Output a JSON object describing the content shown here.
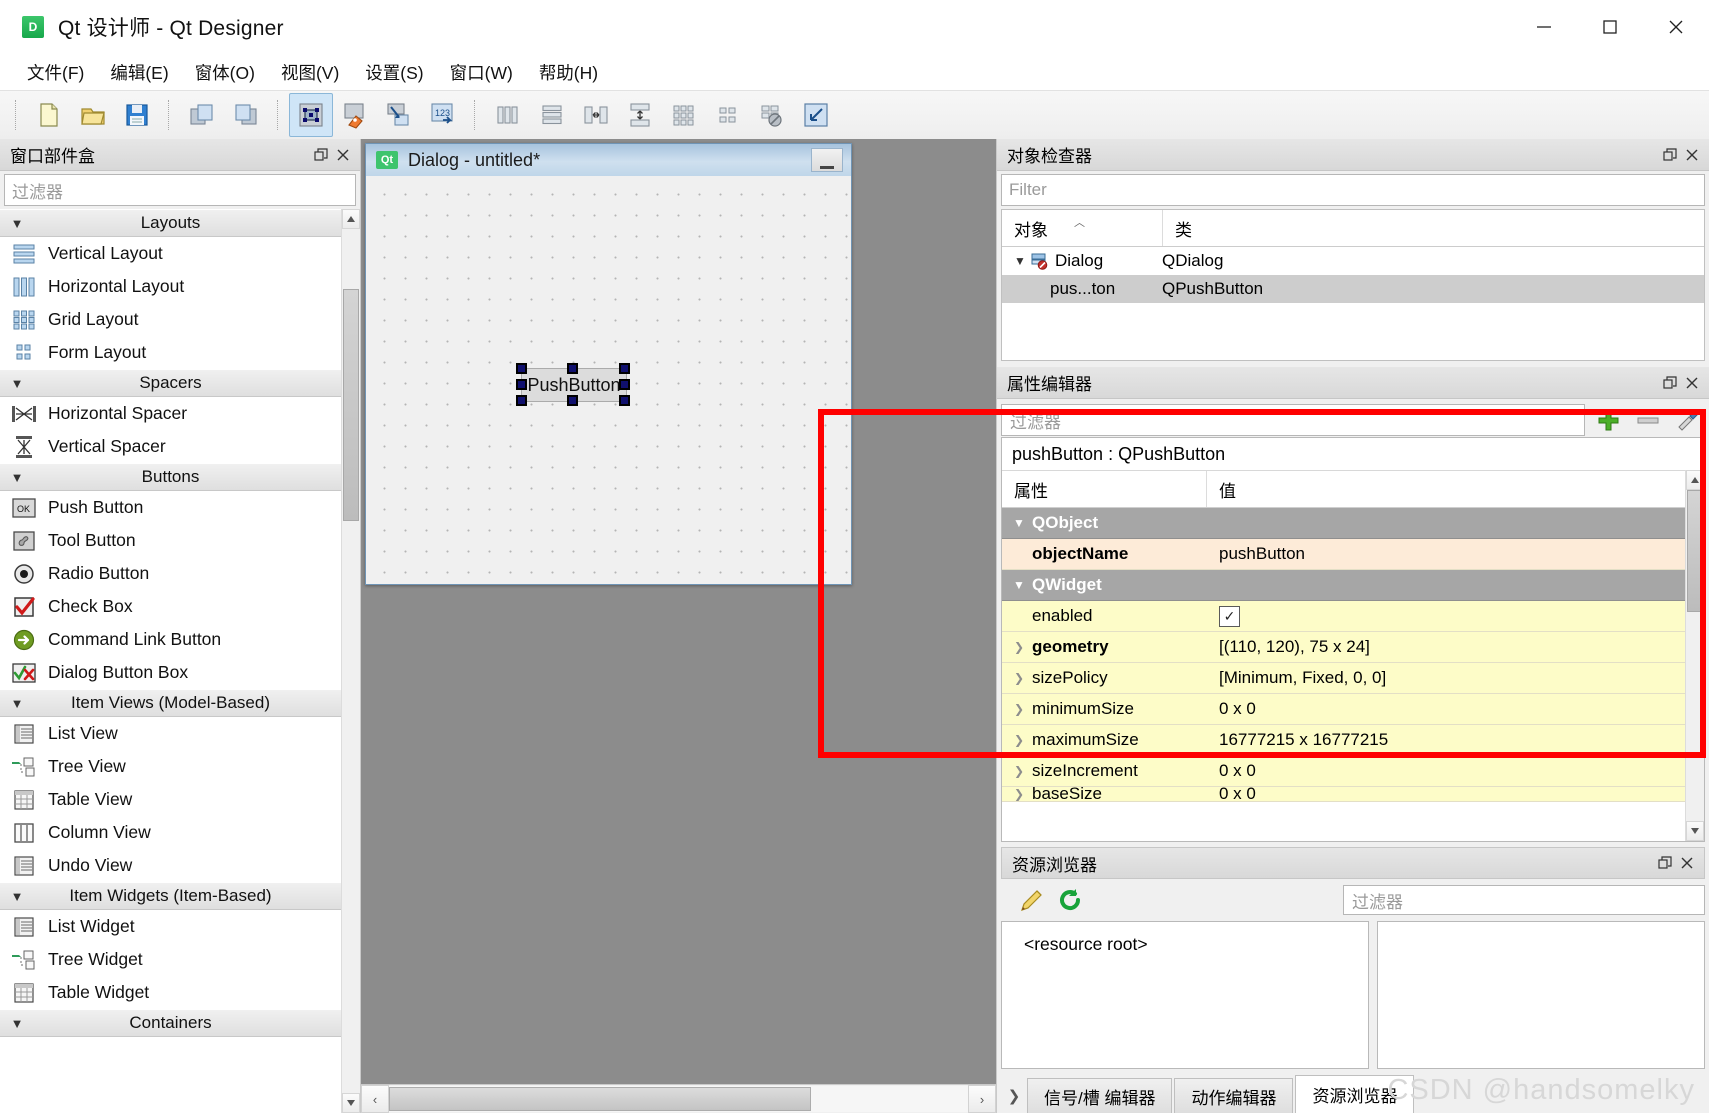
{
  "window": {
    "title": "Qt 设计师 - Qt Designer",
    "icon": "qt-designer-icon",
    "minimize": "−",
    "maximize": "□",
    "close": "✕"
  },
  "menubar": {
    "items": [
      {
        "label": "文件(F)",
        "name": "menu-file"
      },
      {
        "label": "编辑(E)",
        "name": "menu-edit"
      },
      {
        "label": "窗体(O)",
        "name": "menu-form"
      },
      {
        "label": "视图(V)",
        "name": "menu-view"
      },
      {
        "label": "设置(S)",
        "name": "menu-settings"
      },
      {
        "label": "窗口(W)",
        "name": "menu-window"
      },
      {
        "label": "帮助(H)",
        "name": "menu-help"
      }
    ]
  },
  "toolbar": {
    "groups": [
      [
        "new-file-icon",
        "open-file-icon",
        "save-file-icon"
      ],
      [
        "undo-icon",
        "redo-icon"
      ],
      [
        "edit-widgets-icon",
        "edit-signals-slots-icon",
        "edit-buddies-icon",
        "edit-tab-order-icon"
      ],
      [
        "layout-horizontally-icon",
        "layout-vertically-icon",
        "layout-splitter-h-icon",
        "layout-splitter-v-icon",
        "layout-grid-icon",
        "layout-form-icon",
        "break-layout-icon",
        "adjust-size-icon"
      ]
    ]
  },
  "widgetbox": {
    "title": "窗口部件盒",
    "filter_placeholder": "过滤器",
    "float_icon": "float-icon",
    "close_icon": "close-icon",
    "categories": [
      {
        "name": "Layouts",
        "label": "Layouts",
        "items": [
          {
            "label": "Vertical Layout",
            "icon": "vertical-layout-icon"
          },
          {
            "label": "Horizontal Layout",
            "icon": "horizontal-layout-icon"
          },
          {
            "label": "Grid Layout",
            "icon": "grid-layout-icon"
          },
          {
            "label": "Form Layout",
            "icon": "form-layout-icon"
          }
        ]
      },
      {
        "name": "Spacers",
        "label": "Spacers",
        "items": [
          {
            "label": "Horizontal Spacer",
            "icon": "horizontal-spacer-icon"
          },
          {
            "label": "Vertical Spacer",
            "icon": "vertical-spacer-icon"
          }
        ]
      },
      {
        "name": "Buttons",
        "label": "Buttons",
        "items": [
          {
            "label": "Push Button",
            "icon": "push-button-icon"
          },
          {
            "label": "Tool Button",
            "icon": "tool-button-icon"
          },
          {
            "label": "Radio Button",
            "icon": "radio-button-icon"
          },
          {
            "label": "Check Box",
            "icon": "check-box-icon"
          },
          {
            "label": "Command Link Button",
            "icon": "command-link-button-icon"
          },
          {
            "label": "Dialog Button Box",
            "icon": "dialog-button-box-icon"
          }
        ]
      },
      {
        "name": "ItemViews",
        "label": "Item Views (Model-Based)",
        "items": [
          {
            "label": "List View",
            "icon": "list-view-icon"
          },
          {
            "label": "Tree View",
            "icon": "tree-view-icon"
          },
          {
            "label": "Table View",
            "icon": "table-view-icon"
          },
          {
            "label": "Column View",
            "icon": "column-view-icon"
          },
          {
            "label": "Undo View",
            "icon": "undo-view-icon"
          }
        ]
      },
      {
        "name": "ItemWidgets",
        "label": "Item Widgets (Item-Based)",
        "items": [
          {
            "label": "List Widget",
            "icon": "list-widget-icon"
          },
          {
            "label": "Tree Widget",
            "icon": "tree-widget-icon"
          },
          {
            "label": "Table Widget",
            "icon": "table-widget-icon"
          }
        ]
      },
      {
        "name": "Containers",
        "label": "Containers",
        "items": []
      }
    ]
  },
  "form": {
    "title": "Dialog - untitled*",
    "badge": "Qt",
    "minimize_label": "−",
    "widget": {
      "label": "PushButton",
      "name": "pushButton"
    },
    "hscroll": {
      "left": "‹",
      "right": "›"
    }
  },
  "object_inspector": {
    "title": "对象检查器",
    "filter_placeholder": "Filter",
    "columns": [
      "对象",
      "类"
    ],
    "rows": [
      {
        "object": "Dialog",
        "class": "QDialog",
        "level": 0,
        "expanded": true,
        "selected": false
      },
      {
        "object": "pus...ton",
        "class": "QPushButton",
        "level": 1,
        "expanded": false,
        "selected": true
      }
    ]
  },
  "property_editor": {
    "title": "属性编辑器",
    "filter_placeholder": "过滤器",
    "buttons": [
      "add-icon",
      "remove-icon",
      "configure-icon"
    ],
    "object_header": "pushButton : QPushButton",
    "columns": [
      "属性",
      "值"
    ],
    "rows": [
      {
        "kind": "group",
        "key": "QObject",
        "value": "",
        "expanded": true
      },
      {
        "kind": "objname",
        "key": "objectName",
        "value": "pushButton",
        "bold": true
      },
      {
        "kind": "group",
        "key": "QWidget",
        "value": "",
        "expanded": true
      },
      {
        "kind": "prop",
        "key": "enabled",
        "value": "",
        "checkbox": true,
        "checked": true
      },
      {
        "kind": "prop",
        "key": "geometry",
        "value": "[(110, 120), 75 x 24]",
        "bold": true,
        "expandable": true
      },
      {
        "kind": "prop",
        "key": "sizePolicy",
        "value": "[Minimum, Fixed, 0, 0]",
        "expandable": true
      },
      {
        "kind": "prop",
        "key": "minimumSize",
        "value": "0 x 0",
        "expandable": true
      },
      {
        "kind": "prop",
        "key": "maximumSize",
        "value": "16777215 x 16777215",
        "expandable": true
      },
      {
        "kind": "prop",
        "key": "sizeIncrement",
        "value": "0 x 0",
        "expandable": true
      },
      {
        "kind": "prop",
        "key": "baseSize",
        "value": "0 x 0",
        "expandable": true
      }
    ]
  },
  "resource_browser": {
    "title": "资源浏览器",
    "edit_icon": "pencil-edit-icon",
    "reload_icon": "reload-refresh-icon",
    "filter_placeholder": "过滤器",
    "root_label": "<resource root>"
  },
  "bottom_tabs": {
    "items": [
      {
        "label": "信号/槽 编辑器",
        "active": false
      },
      {
        "label": "动作编辑器",
        "active": false
      },
      {
        "label": "资源浏览器",
        "active": true
      }
    ]
  },
  "annotation": {
    "highlight_color": "#ff0000"
  },
  "watermark": "CSDN @handsomelky"
}
